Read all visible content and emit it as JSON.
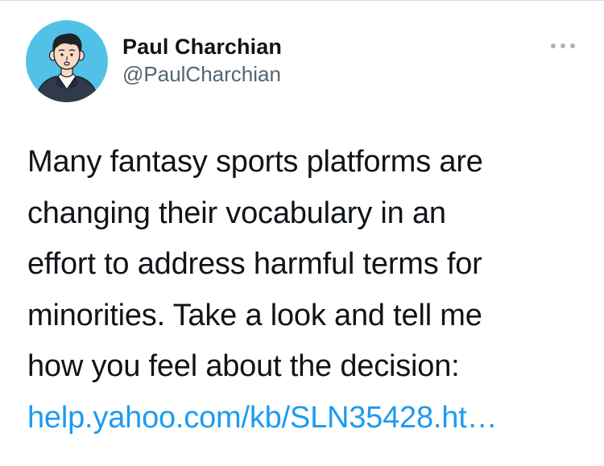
{
  "author": {
    "display_name": "Paul Charchian",
    "handle": "@PaulCharchian",
    "avatar_icon": "cartoon-avatar-icon"
  },
  "more_icon": "ellipsis-icon",
  "tweet": {
    "lines": [
      "Many fantasy sports platforms are",
      "changing their vocabulary in an",
      "effort to address harmful terms for",
      "minorities. Take a look and tell me",
      "how you feel about the decision:"
    ],
    "link_text": "help.yahoo.com/kb/SLN35428.ht…"
  },
  "colors": {
    "link": "#1d9bf0",
    "avatar_bg": "#52c1e8",
    "handle": "#536471"
  }
}
